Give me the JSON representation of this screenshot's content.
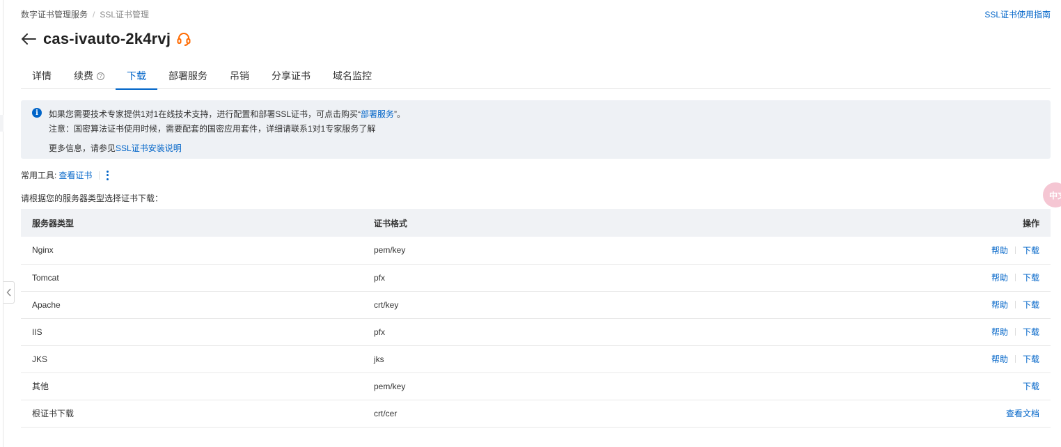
{
  "breadcrumb": {
    "root": "数字证书管理服务",
    "separator": "/",
    "current": "SSL证书管理"
  },
  "guide_link": "SSL证书使用指南",
  "page_title": "cas-ivauto-2k4rvj",
  "tabs": [
    {
      "label": "详情",
      "active": false
    },
    {
      "label": "续费",
      "active": false,
      "help": "?"
    },
    {
      "label": "下载",
      "active": true
    },
    {
      "label": "部署服务",
      "active": false
    },
    {
      "label": "吊销",
      "active": false
    },
    {
      "label": "分享证书",
      "active": false
    },
    {
      "label": "域名监控",
      "active": false
    }
  ],
  "notice": {
    "line1_prefix": "如果您需要技术专家提供1对1在线技术支持，进行配置和部署SSL证书，可点击购买“",
    "line1_link": "部署服务",
    "line1_suffix": "”。",
    "line2": "注意：国密算法证书使用时候，需要配套的国密应用套件，详细请联系1对1专家服务了解",
    "line3_prefix": "更多信息，请参见",
    "line3_link": "SSL证书安装说明"
  },
  "tools": {
    "label": "常用工具:",
    "view_cert": "查看证书"
  },
  "select_hint": "请根据您的服务器类型选择证书下载：",
  "table": {
    "headers": {
      "type": "服务器类型",
      "format": "证书格式",
      "ops": "操作"
    },
    "rows": [
      {
        "type": "Nginx",
        "format": "pem/key",
        "help": "帮助",
        "action": "下载"
      },
      {
        "type": "Tomcat",
        "format": "pfx",
        "help": "帮助",
        "action": "下载"
      },
      {
        "type": "Apache",
        "format": "crt/key",
        "help": "帮助",
        "action": "下载"
      },
      {
        "type": "IIS",
        "format": "pfx",
        "help": "帮助",
        "action": "下载"
      },
      {
        "type": "JKS",
        "format": "jks",
        "help": "帮助",
        "action": "下载"
      },
      {
        "type": "其他",
        "format": "pem/key",
        "help": "",
        "action": "下载"
      },
      {
        "type": "根证书下载",
        "format": "crt/cer",
        "help": "",
        "action": "查看文档"
      }
    ]
  },
  "lang_bubble": "中文",
  "colors": {
    "link": "#0064c8",
    "accent_orange": "#ff6a00",
    "notice_bg": "#eef1f5",
    "table_header_bg": "#f0f2f5"
  },
  "icons": {
    "back": "arrow-left-icon",
    "support": "headset-icon",
    "info": "info-icon",
    "more": "more-vertical-icon",
    "collapse": "chevron-left-icon"
  }
}
